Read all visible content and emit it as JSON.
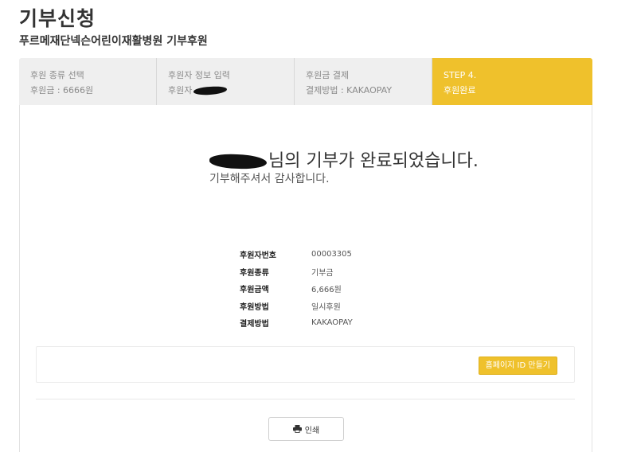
{
  "page": {
    "title": "기부신청",
    "subtitle": "푸르메재단넥슨어린이재활병원 기부후원"
  },
  "steps": [
    {
      "line1": "후원 종류 선택",
      "line2": "후원금 : 6666원"
    },
    {
      "line1": "후원자 정보 입력",
      "line2": "후원자"
    },
    {
      "line1": "후원금 결제",
      "line2": "결제방법 : KAKAOPAY"
    },
    {
      "line1": "STEP 4.",
      "line2": "후원완료"
    }
  ],
  "complete": {
    "message": "님의 기부가 완료되었습니다.",
    "thanks": "기부해주셔서 감사합니다."
  },
  "info": [
    {
      "label": "후원자번호",
      "value": "00003305"
    },
    {
      "label": "후원종류",
      "value": "기부금"
    },
    {
      "label": "후원금액",
      "value": "6,666원"
    },
    {
      "label": "후원방법",
      "value": "일시후원"
    },
    {
      "label": "결제방법",
      "value": "KAKAOPAY"
    }
  ],
  "buttons": {
    "homepage_id": "홈페이지 ID 만들기",
    "print": "인쇄"
  },
  "colors": {
    "accent": "#efc12c",
    "step_inactive_bg": "#efefef"
  },
  "icons": {
    "print": "printer-icon"
  }
}
